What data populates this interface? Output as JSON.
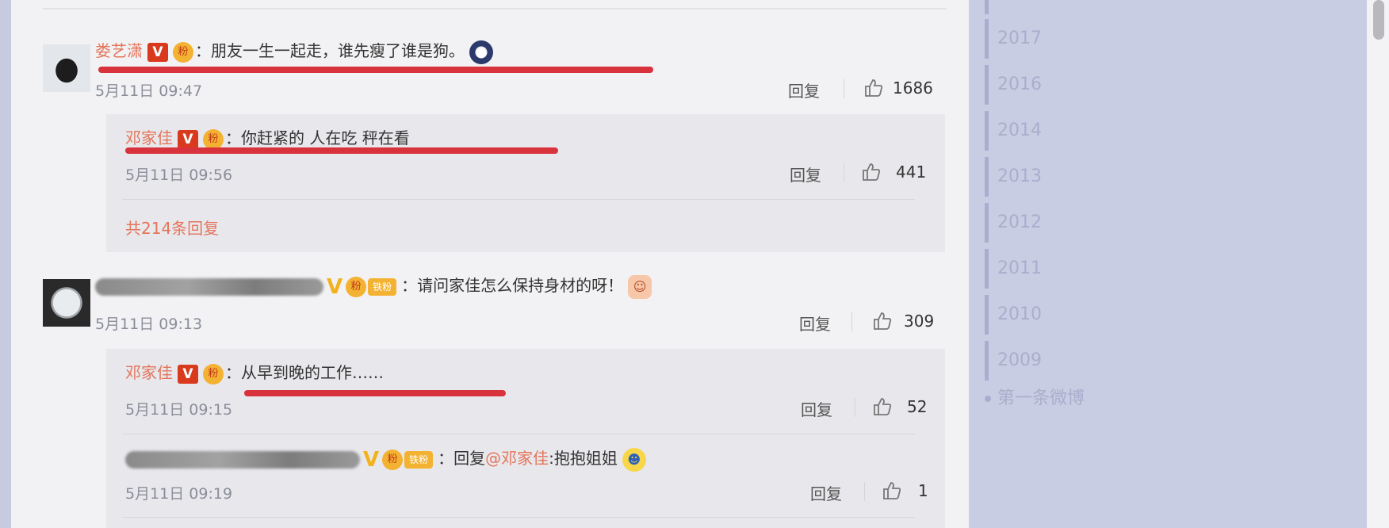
{
  "comments": [
    {
      "user": "娄艺潇",
      "text": "朋友一生一起走，谁先瘦了谁是狗。",
      "time": "5月11日 09:47",
      "reply_label": "回复",
      "likes": "1686",
      "replies": [
        {
          "user": "邓家佳",
          "text": "你赶紧的 人在吃 秤在看",
          "time": "5月11日 09:56",
          "reply_label": "回复",
          "likes": "441"
        }
      ],
      "more_replies": "共214条回复"
    },
    {
      "user_hidden": true,
      "badge_tag": "铁粉",
      "text": "请问家佳怎么保持身材的呀！",
      "time": "5月11日 09:13",
      "reply_label": "回复",
      "likes": "309",
      "replies": [
        {
          "user": "邓家佳",
          "text": "从早到晚的工作……",
          "time": "5月11日 09:15",
          "reply_label": "回复",
          "likes": "52"
        },
        {
          "user_hidden": true,
          "badge_tag": "铁粉",
          "prefix": "回复",
          "mention": "@邓家佳",
          "text": ":抱抱姐姐",
          "time": "5月11日 09:19",
          "reply_label": "回复",
          "likes": "1"
        }
      ]
    }
  ],
  "timeline": {
    "years": [
      "2017",
      "2016",
      "2014",
      "2013",
      "2012",
      "2011",
      "2010",
      "2009"
    ],
    "first_post": "第一条微博"
  },
  "colors": {
    "username": "#e3755b",
    "verified_badge": "#d93a1e",
    "underline": "#d8323c",
    "sidebar_bg": "#c9cde3"
  }
}
